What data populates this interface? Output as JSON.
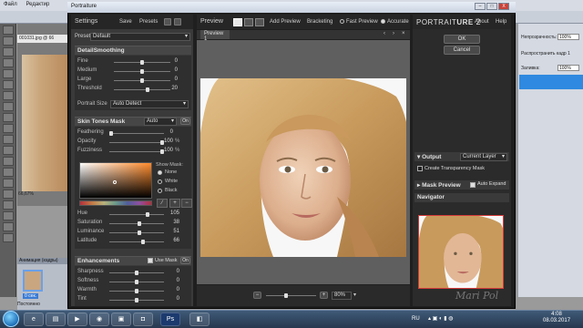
{
  "ps": {
    "menu": [
      "Файл",
      "Редактир"
    ],
    "doc_tab": "001031.jpg @ 66",
    "zoom": "66,67%",
    "layers_title": "Анимация (кадры)",
    "layer_label": "0 сек.",
    "status": "Постоянно",
    "right": {
      "opacity_label": "Непрозрачность:",
      "opacity_value": "100%",
      "spread_label": "Распространить кадр 1",
      "fill_label": "Заливка:",
      "fill_value": "100%"
    }
  },
  "portraiture": {
    "window_title": "Portraiture",
    "title_controls": [
      "–",
      "□",
      "X"
    ],
    "settings": {
      "title": "Settings",
      "save": "Save",
      "presets": "Presets",
      "preset_label": "Preset",
      "preset_value": "Default"
    },
    "detail_smoothing": {
      "title": "DetailSmoothing",
      "rows": [
        {
          "label": "Fine",
          "value": "0",
          "pos": 0.5
        },
        {
          "label": "Medium",
          "value": "0",
          "pos": 0.5
        },
        {
          "label": "Large",
          "value": "0",
          "pos": 0.5
        },
        {
          "label": "Threshold",
          "value": "20",
          "pos": 0.6
        }
      ],
      "portrait_size_label": "Portrait Size",
      "portrait_size_value": "Auto Detect"
    },
    "skin_tones": {
      "title": "Skin Tones Mask",
      "mode": "Auto",
      "toggle": "On",
      "rows": [
        {
          "label": "Feathering",
          "value": "0",
          "pct": "",
          "pos": 0.0
        },
        {
          "label": "Opacity",
          "value": "100",
          "pct": "%",
          "pos": 1.0
        },
        {
          "label": "Fuzziness",
          "value": "100",
          "pct": "%",
          "pos": 1.0
        }
      ],
      "show_mask_label": "Show Mask:",
      "show_mask_options": [
        "None",
        "White",
        "Black"
      ],
      "show_mask_selected": 0,
      "hsl_rows": [
        {
          "label": "Hue",
          "value": "105",
          "pos": 0.72
        },
        {
          "label": "Saturation",
          "value": "38",
          "pos": 0.55
        },
        {
          "label": "Luminance",
          "value": "51",
          "pos": 0.55
        },
        {
          "label": "Latitude",
          "value": "66",
          "pos": 0.62
        }
      ]
    },
    "enhancements": {
      "title": "Enhancements",
      "use_mask": "Use Mask",
      "toggle": "On",
      "rows": [
        {
          "label": "Sharpness",
          "value": "0",
          "pos": 0.5
        },
        {
          "label": "Softness",
          "value": "0",
          "pos": 0.5
        },
        {
          "label": "Warmth",
          "value": "0",
          "pos": 0.5
        },
        {
          "label": "Tint",
          "value": "0",
          "pos": 0.5
        }
      ]
    },
    "preview": {
      "title": "Preview",
      "add_preview": "Add Preview",
      "bracketing": "Bracketing",
      "fast_preview": "Fast Preview",
      "accurate": "Accurate",
      "mode_selected": "accurate",
      "tab": "Preview 1",
      "zoom": "80%"
    },
    "right": {
      "brand_1": "PORTRAIT",
      "brand_2": "URE",
      "brand_ver": "2",
      "about": "About",
      "help": "Help",
      "ok": "OK",
      "cancel": "Cancel",
      "output_title": "Output",
      "output_value": "Current Layer",
      "create_transparency": "Create Transparency Mask",
      "mask_preview": "Mask Preview",
      "auto_expand": "Auto Expand",
      "navigator": "Navigator"
    }
  },
  "taskbar": {
    "lang": "RU",
    "time": "4:08",
    "date": "08.03.2017"
  },
  "colors": {
    "skin_swatch": "#ff8a2a",
    "accent_blue": "#2f89e0"
  }
}
